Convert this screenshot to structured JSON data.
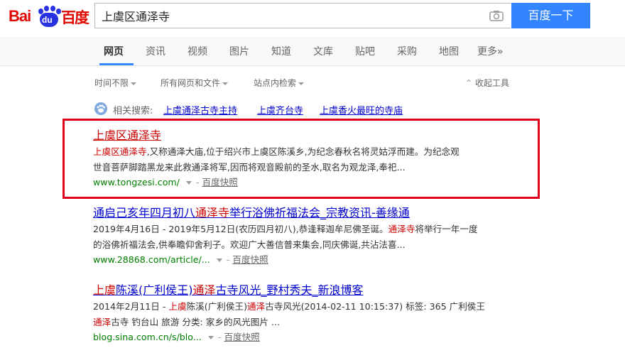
{
  "logo": {
    "bai": "Bai",
    "du": "du",
    "cn": "百度"
  },
  "search": {
    "query": "上虞区通泽寺",
    "button_label": "百度一下"
  },
  "nav": {
    "tabs": [
      {
        "label": "网页"
      },
      {
        "label": "资讯"
      },
      {
        "label": "视频"
      },
      {
        "label": "图片"
      },
      {
        "label": "知道"
      },
      {
        "label": "文库"
      },
      {
        "label": "贴吧"
      },
      {
        "label": "采购"
      },
      {
        "label": "地图"
      },
      {
        "label": "更多»"
      }
    ]
  },
  "filters": {
    "time": "时间不限",
    "type": "所有网页和文件",
    "site": "站点内检索",
    "collapse": "收起工具"
  },
  "related": {
    "label": "相关搜索:",
    "links": [
      "上虞通泽古寺主持",
      "上虞齐台寺",
      "上虞香火最旺的寺庙"
    ]
  },
  "results": [
    {
      "title": "上虞区通泽寺",
      "desc_hl": "上虞区通泽寺",
      "desc_1": ",又称通泽大庙,位于绍兴市上虞区陈溪乡,为纪念春秋名将灵姑浮而建。为纪念观",
      "desc_2": "世音菩萨脚踏黑龙来此救通泽将军,因而将观音殿前的圣水,取名为观龙泽,奉祀...",
      "url": "www.tongzesi.com/",
      "cache": "百度快照"
    },
    {
      "title_a": "通启己亥年四月初八",
      "title_hl": "通泽寺",
      "title_b": "举行浴佛祈福法会_宗教资讯-善缘通",
      "desc_a": "2019年4月16日 - 2019年5月12日(农历四月初八),恭逢释迦牟尼佛圣诞。",
      "desc_hl": "通泽寺",
      "desc_b": "将举行一年一度",
      "desc_2": "的浴佛祈福法会,供奉瞻仰舍利子。欢迎广大善信普来集会,同庆佛诞,共沾法喜...",
      "url": "www.28868.com/article/...",
      "cache": "百度快照"
    },
    {
      "title_hl1": "上虞",
      "title_a": "陈溪(广利侯王)",
      "title_hl2": "通泽",
      "title_b": "古寺风光_野村秀夫_新浪博客",
      "desc_a": "2014年2月11日 - ",
      "desc_hl1": "上虞",
      "desc_b": "陈溪(广利侯王)",
      "desc_hl2": "通泽",
      "desc_c": "古寺风光(2014-02-11 10:15:37) 标签: 365 广利侯王",
      "desc_hl3": "通泽",
      "desc_2": "古寺 钓台山 旅游 分类: 家乡的风光图片 ...",
      "url": "blog.sina.com.cn/s/blo...",
      "cache": "百度快照"
    }
  ],
  "colors": {
    "brand_red": "#e10602",
    "brand_blue": "#2932e1",
    "button": "#3385ff",
    "link": "#0000cc",
    "url_green": "#008000",
    "highlight_box": "#e0001b"
  }
}
